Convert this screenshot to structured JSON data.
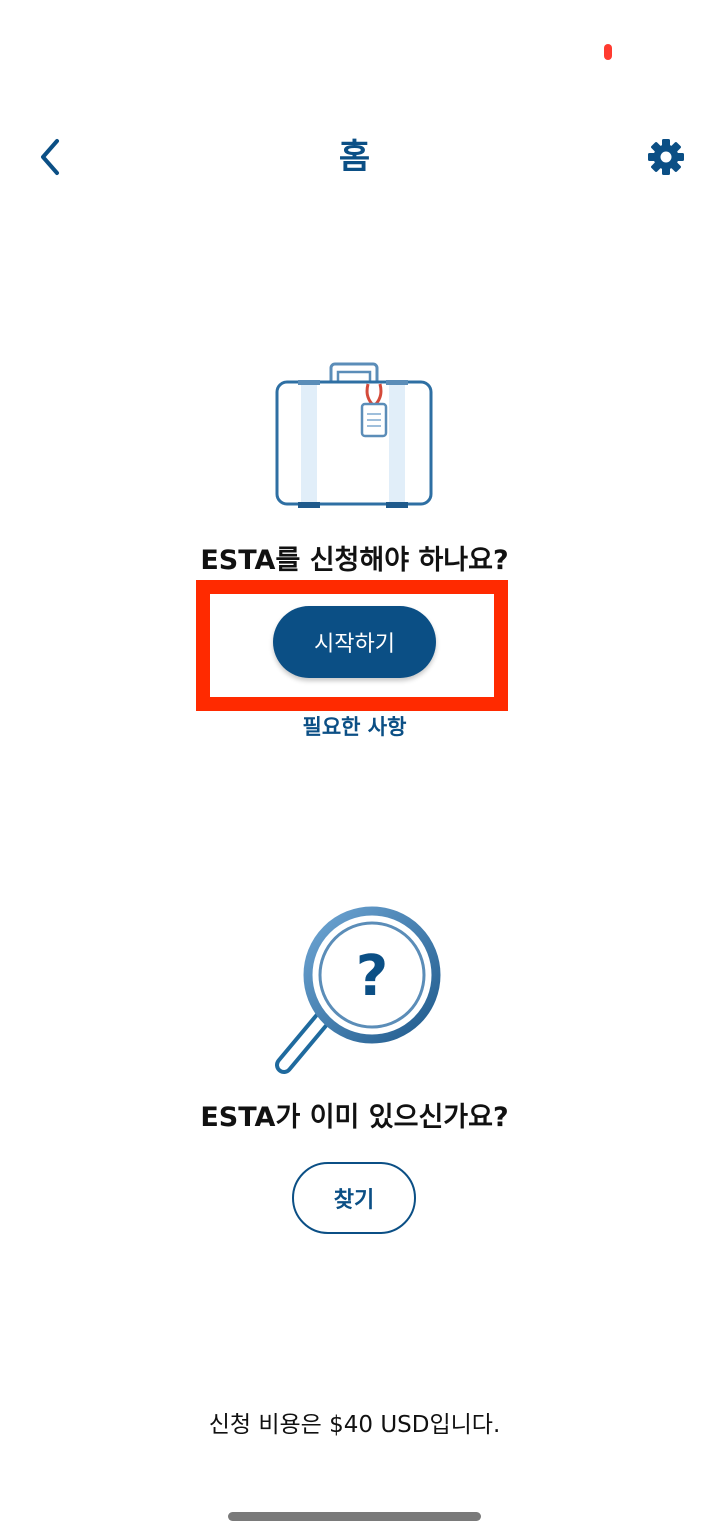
{
  "header": {
    "title": "홈",
    "back_icon": "chevron-left-icon",
    "settings_icon": "gear-icon"
  },
  "apply_section": {
    "illustration": "suitcase-icon",
    "question": "ESTA를 신청해야 하나요?",
    "start_button_label": "시작하기",
    "requirements_link": "필요한 사항"
  },
  "existing_section": {
    "illustration": "magnifier-question-icon",
    "question": "ESTA가 이미 있으신가요?",
    "find_button_label": "찾기"
  },
  "footer": {
    "fee_text": "신청 비용은 $40 USD입니다."
  },
  "colors": {
    "primary": "#0b4f85",
    "highlight": "#ff2a00",
    "status_dot": "#ff3b30"
  }
}
